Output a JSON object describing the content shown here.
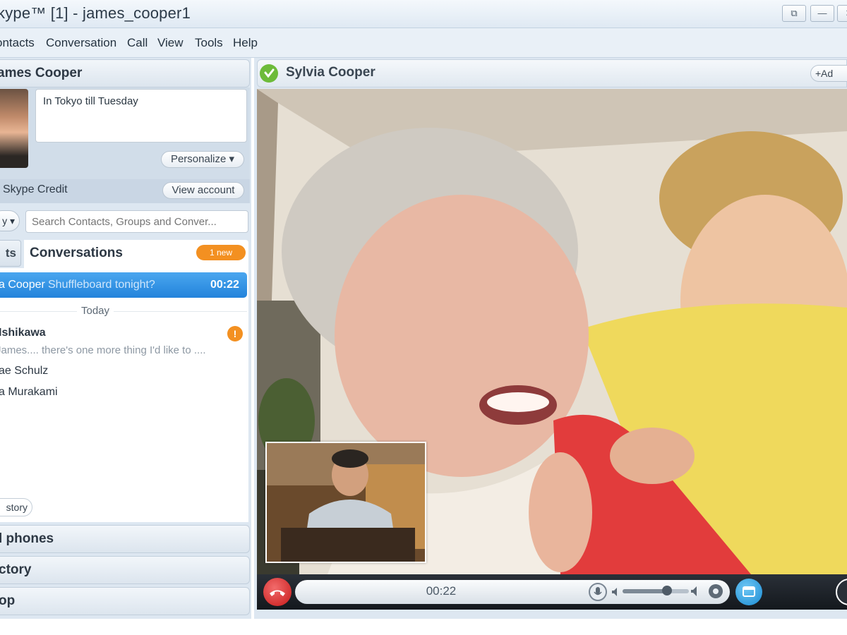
{
  "window": {
    "title": "kype™ [1] - james_cooper1",
    "restore_label": "⧉",
    "minimize_label": "—",
    "close_label": "✕"
  },
  "menu": {
    "items": [
      "ontacts",
      "Conversation",
      "Call",
      "View",
      "Tools",
      "Help"
    ]
  },
  "profile": {
    "name": "ames Cooper",
    "mood": "In Tokyo till Tuesday",
    "personalize_label": "Personalize ▾",
    "credit_label": "Skype Credit",
    "view_account_label": "View account"
  },
  "search": {
    "status_label": "y ▾",
    "placeholder": "Search Contacts, Groups and Conver..."
  },
  "tabs": {
    "contacts_label": "ts",
    "conversations_label": "Conversations",
    "new_badge": "1 new"
  },
  "conversations": {
    "active": {
      "name": "a Cooper",
      "snippet": "Shuffleboard tonight?",
      "time": "00:22"
    },
    "group_label": "Today",
    "items": [
      {
        "name": "Ishikawa",
        "snippet": "James.... there's one more thing I'd like to ....",
        "unread": "!"
      },
      {
        "name": "ae Schulz"
      },
      {
        "name": "a Murakami"
      }
    ],
    "history_label": "story"
  },
  "sections": {
    "phones_label": "l phones",
    "directory_label": "ctory",
    "shop_label": "op"
  },
  "call": {
    "contact_name": "Sylvia Cooper",
    "add_label": "Ad",
    "duration": "00:22",
    "volume_level": 0.7
  },
  "colors": {
    "accent_blue": "#2283db",
    "new_badge_orange": "#f39021",
    "hangup_red": "#d32020",
    "online_green": "#6dbb3a"
  }
}
